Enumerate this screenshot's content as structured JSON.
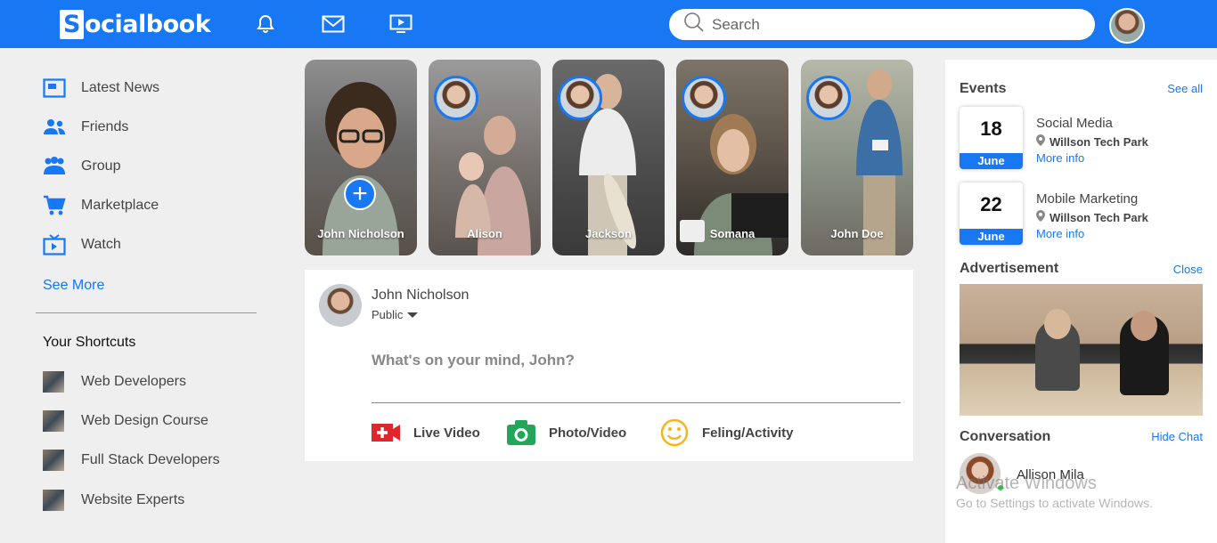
{
  "header": {
    "logo_letter": "S",
    "logo_rest": "ocialbook",
    "search_placeholder": "Search",
    "icons": [
      "bell-icon",
      "mail-icon",
      "video-icon"
    ]
  },
  "sidebar": {
    "items": [
      {
        "label": "Latest News",
        "icon": "news-icon"
      },
      {
        "label": "Friends",
        "icon": "friends-icon"
      },
      {
        "label": "Group",
        "icon": "group-icon"
      },
      {
        "label": "Marketplace",
        "icon": "cart-icon"
      },
      {
        "label": "Watch",
        "icon": "tv-icon"
      }
    ],
    "see_more": "See More",
    "shortcuts_title": "Your Shortcuts",
    "shortcuts": [
      {
        "label": "Web Developers"
      },
      {
        "label": "Web Design Course"
      },
      {
        "label": "Full Stack Developers"
      },
      {
        "label": "Website Experts"
      }
    ]
  },
  "stories": [
    {
      "name": "John Nicholson"
    },
    {
      "name": "Alison"
    },
    {
      "name": "Jackson"
    },
    {
      "name": "Somana"
    },
    {
      "name": "John Doe"
    }
  ],
  "post": {
    "author": "John Nicholson",
    "visibility": "Public",
    "placeholder": "What's on your mind, John?",
    "actions": [
      {
        "label": "Live Video",
        "icon": "live-video-icon"
      },
      {
        "label": "Photo/Video",
        "icon": "camera-icon"
      },
      {
        "label": "Feling/Activity",
        "icon": "smiley-icon"
      }
    ]
  },
  "right": {
    "events_title": "Events",
    "see_all": "See all",
    "events": [
      {
        "day": "18",
        "month": "June",
        "title": "Social Media",
        "location": "Willson Tech Park",
        "more": "More info"
      },
      {
        "day": "22",
        "month": "June",
        "title": "Mobile Marketing",
        "location": "Willson Tech Park",
        "more": "More info"
      }
    ],
    "ad_title": "Advertisement",
    "close": "Close",
    "conv_title": "Conversation",
    "hide_chat": "Hide Chat",
    "contact": "Allison Mila"
  },
  "watermark": {
    "line1": "Activate Windows",
    "line2": "Go to Settings to activate Windows."
  },
  "colors": {
    "brand": "#1877f2",
    "online": "#2ecc40"
  }
}
